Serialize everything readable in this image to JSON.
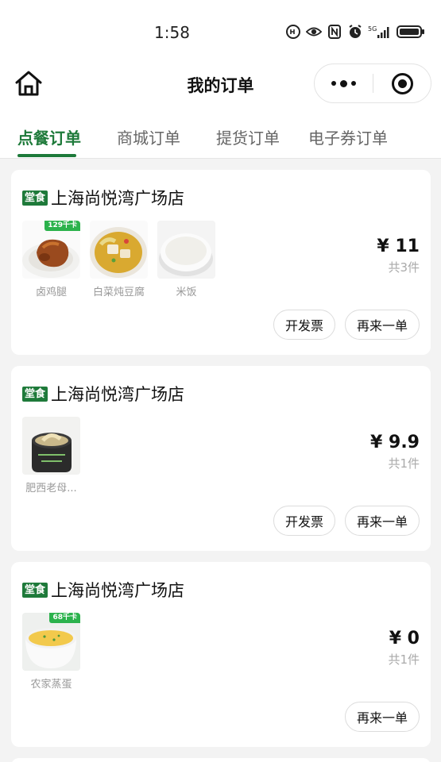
{
  "status_bar": {
    "time": "1:58"
  },
  "nav": {
    "title": "我的订单"
  },
  "tabs": [
    {
      "label": "点餐订单",
      "active": true
    },
    {
      "label": "商城订单",
      "active": false
    },
    {
      "label": "提货订单",
      "active": false
    },
    {
      "label": "电子券订单",
      "active": false
    }
  ],
  "orders": [
    {
      "badge": "堂食",
      "store": "上海尚悦湾广场店",
      "items": [
        {
          "name": "卤鸡腿",
          "kcal": "129千卡",
          "icon": "braised-chicken-leg"
        },
        {
          "name": "白菜炖豆腐",
          "icon": "cabbage-tofu-stew"
        },
        {
          "name": "米饭",
          "icon": "rice-bowl"
        }
      ],
      "price": "¥ 11",
      "count": "共3件",
      "buttons": [
        "开发票",
        "再来一单"
      ]
    },
    {
      "badge": "堂食",
      "store": "上海尚悦湾广场店",
      "items": [
        {
          "name": "肥西老母...",
          "icon": "hen-soup-pot"
        }
      ],
      "price": "¥ 9.9",
      "count": "共1件",
      "buttons": [
        "开发票",
        "再来一单"
      ]
    },
    {
      "badge": "堂食",
      "store": "上海尚悦湾广场店",
      "items": [
        {
          "name": "农家蒸蛋",
          "kcal": "68千卡",
          "icon": "steamed-egg"
        }
      ],
      "price": "¥ 0",
      "count": "共1件",
      "buttons": [
        "再来一单"
      ]
    }
  ],
  "colors": {
    "accent": "#1e7a3a",
    "kcal_badge": "#2bb24c",
    "background": "#f3f3f3"
  }
}
